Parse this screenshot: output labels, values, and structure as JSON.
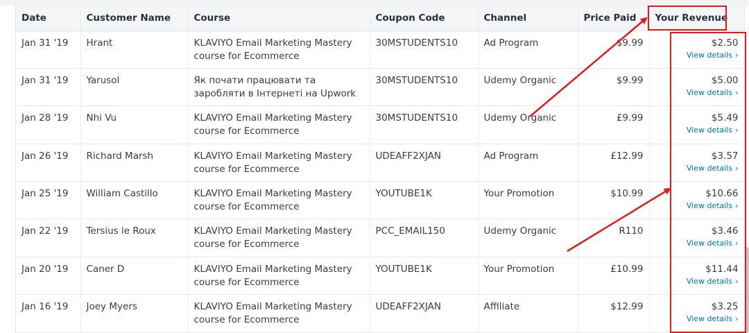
{
  "table": {
    "headers": {
      "date": "Date",
      "customer": "Customer Name",
      "course": "Course",
      "coupon": "Coupon Code",
      "channel": "Channel",
      "price": "Price Paid",
      "revenue": "Your Revenue"
    },
    "view_details_label": "View details",
    "rows": [
      {
        "date": "Jan 31 '19",
        "customer": "Hrant",
        "course": "KLAVIYO Email Marketing Mastery course for Ecommerce",
        "coupon": "30MSTUDENTS10",
        "channel": "Ad Program",
        "price": "$9.99",
        "revenue": "$2.50"
      },
      {
        "date": "Jan 31 '19",
        "customer": "Yarusol",
        "course": "Як почати працювати та заробляти в Інтернеті на Upwork",
        "coupon": "30MSTUDENTS10",
        "channel": "Udemy Organic",
        "price": "$9.99",
        "revenue": "$5.00"
      },
      {
        "date": "Jan 28 '19",
        "customer": "Nhi Vu",
        "course": "KLAVIYO Email Marketing Mastery course for Ecommerce",
        "coupon": "30MSTUDENTS10",
        "channel": "Udemy Organic",
        "price": "£9.99",
        "revenue": "$5.49"
      },
      {
        "date": "Jan 26 '19",
        "customer": "Richard Marsh",
        "course": "KLAVIYO Email Marketing Mastery course for Ecommerce",
        "coupon": "UDEAFF2XJAN",
        "channel": "Ad Program",
        "price": "£12.99",
        "revenue": "$3.57"
      },
      {
        "date": "Jan 25 '19",
        "customer": "William Castillo",
        "course": "KLAVIYO Email Marketing Mastery course for Ecommerce",
        "coupon": "YOUTUBE1K",
        "channel": "Your Promotion",
        "price": "$10.99",
        "revenue": "$10.66"
      },
      {
        "date": "Jan 22 '19",
        "customer": "Tersius le Roux",
        "course": "KLAVIYO Email Marketing Mastery course for Ecommerce",
        "coupon": "PCC_EMAIL150",
        "channel": "Udemy Organic",
        "price": "R110",
        "revenue": "$3.46"
      },
      {
        "date": "Jan 20 '19",
        "customer": "Caner D",
        "course": "KLAVIYO Email Marketing Mastery course for Ecommerce",
        "coupon": "YOUTUBE1K",
        "channel": "Your Promotion",
        "price": "£10.99",
        "revenue": "$11.44"
      },
      {
        "date": "Jan 16 '19",
        "customer": "Joey Myers",
        "course": "KLAVIYO Email Marketing Mastery course for Ecommerce",
        "coupon": "UDEAFF2XJAN",
        "channel": "Affiliate",
        "price": "$12.99",
        "revenue": "$3.25"
      }
    ]
  },
  "colors": {
    "annotation_red": "#e11b1b",
    "link_teal": "#007791",
    "header_bg": "#f4f5f7"
  },
  "icons": {
    "view_details_chevron": "chevron-right-icon"
  }
}
